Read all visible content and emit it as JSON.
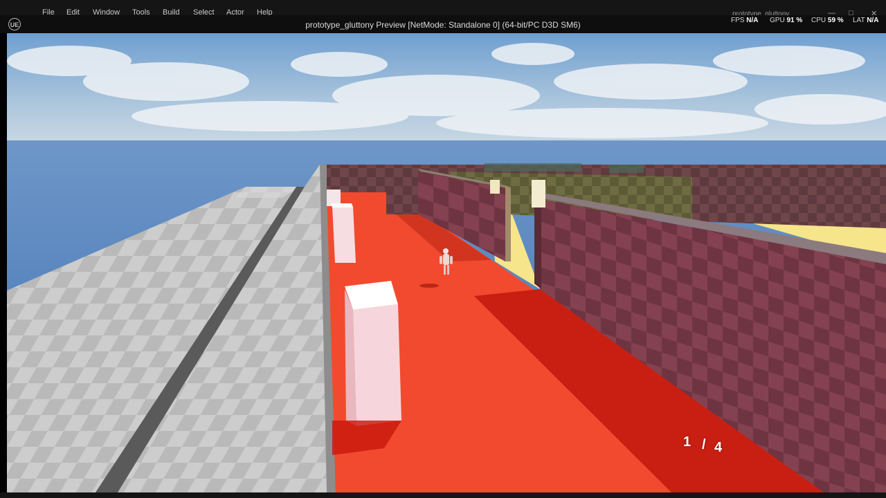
{
  "menu": {
    "file": "File",
    "edit": "Edit",
    "window": "Window",
    "tools": "Tools",
    "build": "Build",
    "select": "Select",
    "actor": "Actor",
    "help": "Help"
  },
  "window": {
    "title": "prototype_gluttony Preview [NetMode: Standalone 0]  (64-bit/PC D3D SM6)",
    "project": "prototype_gluttony",
    "logo": "UE"
  },
  "stats": {
    "fps_label": "FPS",
    "fps_value": "N/A",
    "gpu_label": "GPU",
    "gpu_value": "91 %",
    "cpu_label": "CPU",
    "cpu_value": "59 %",
    "lat_label": "LAT",
    "lat_value": "N/A"
  },
  "hud": {
    "current": "1",
    "separator": "/",
    "total": "4"
  },
  "icons": {
    "logo": "unreal-logo-icon",
    "minimize": "minimize-icon",
    "maximize": "maximize-icon",
    "close": "close-icon"
  },
  "colors": {
    "floor": "#f24a2f",
    "wall": "#7a3a48",
    "yellow_floor": "#f6e58a",
    "sky": "#8fb4d6"
  }
}
